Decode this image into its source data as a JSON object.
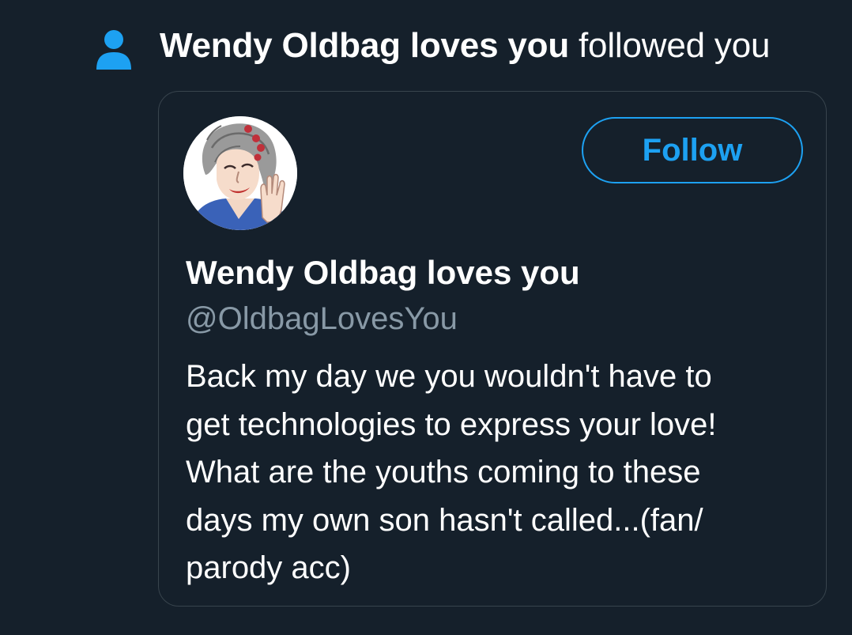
{
  "notification": {
    "icon": "person-icon",
    "follower_name": "Wendy Oldbag loves you",
    "action_text": "followed you"
  },
  "profile_card": {
    "avatar": "avatar-image",
    "follow_button_label": "Follow",
    "display_name": "Wendy Oldbag loves you",
    "handle": "@OldbagLovesYou",
    "bio_lines": [
      "Back my day we you wouldn't have to",
      "get technologies to express your love!",
      "What are the youths coming to these",
      "days my own son hasn't called...(fan/",
      "parody acc)"
    ]
  },
  "colors": {
    "background": "#15202b",
    "accent": "#1da1f2",
    "secondary_text": "#8899a6",
    "card_border": "#38444d"
  }
}
